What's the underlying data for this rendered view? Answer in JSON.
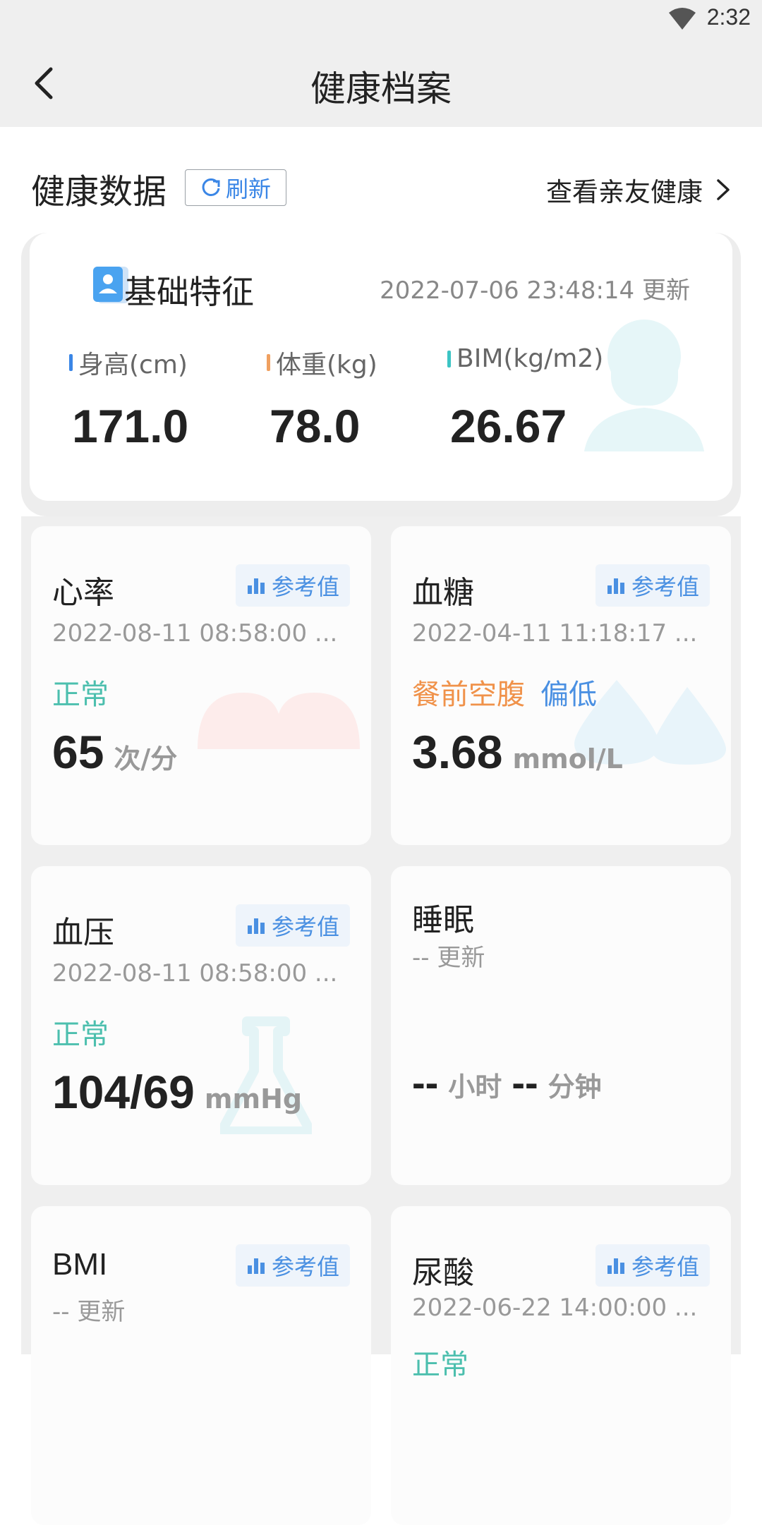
{
  "status_bar": {
    "time": "2:32"
  },
  "header": {
    "title": "健康档案"
  },
  "section": {
    "title": "健康数据",
    "refresh_label": "刷新",
    "friends_label": "查看亲友健康"
  },
  "basic": {
    "title": "基础特征",
    "updated": "2022-07-06 23:48:14  更新",
    "metrics": [
      {
        "label": "身高(cm)",
        "value": "171.0",
        "color": "#3a86e6"
      },
      {
        "label": "体重(kg)",
        "value": "78.0",
        "color": "#f0a060"
      },
      {
        "label": "BIM(kg/m2)",
        "value": "26.67",
        "color": "#3cc4c4"
      }
    ]
  },
  "ref_label": "参考值",
  "tiles": {
    "heart": {
      "title": "心率",
      "date": "2022-08-11 08:58:00 ...",
      "status": "正常",
      "value": "65",
      "unit": "次/分"
    },
    "sugar": {
      "title": "血糖",
      "date": "2022-04-11 11:18:17 ...",
      "status_1": "餐前空腹",
      "status_2": "偏低",
      "value": "3.68",
      "unit": "mmol/L"
    },
    "pressure": {
      "title": "血压",
      "date": "2022-08-11 08:58:00 ...",
      "status": "正常",
      "value": "104/69",
      "unit": "mmHg"
    },
    "sleep": {
      "title": "睡眠",
      "date": "-- 更新",
      "hours": "--",
      "hours_unit": "小时",
      "minutes": "--",
      "minutes_unit": "分钟"
    },
    "bmi": {
      "title": "BMI",
      "date": "-- 更新"
    },
    "uric": {
      "title": "尿酸",
      "date": "2022-06-22 14:00:00 ...",
      "status": "正常"
    }
  },
  "colors": {
    "normal": "#4cbfae",
    "fasting": "#f0924a",
    "low": "#4a90e2",
    "accent_blue": "#3a86e6"
  }
}
